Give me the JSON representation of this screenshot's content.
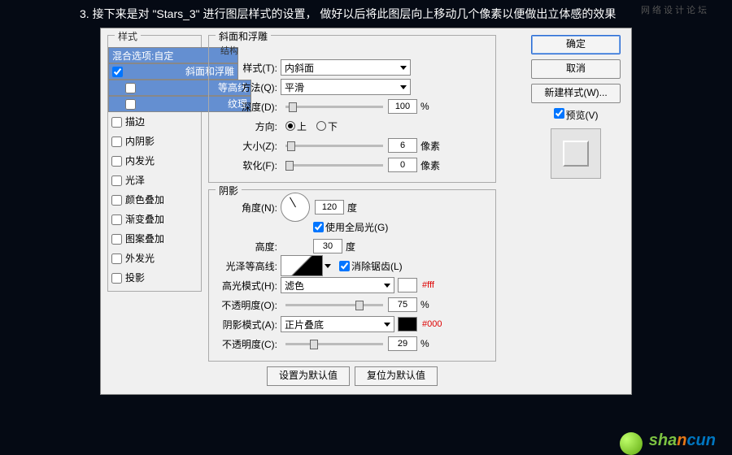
{
  "instruction": "3. 接下来是对 \"Stars_3\" 进行图层样式的设置，   做好以后将此图层向上移动几个像素以便做出立体感的效果",
  "watermark": "网络设计论坛",
  "styles": {
    "heading": "样式",
    "blend": "混合选项:自定",
    "items": [
      {
        "label": "斜面和浮雕",
        "checked": true,
        "sel": true,
        "indent": 0
      },
      {
        "label": "等高线",
        "checked": false,
        "sel": true,
        "indent": 1
      },
      {
        "label": "纹理",
        "checked": false,
        "sel": true,
        "indent": 1
      },
      {
        "label": "描边",
        "checked": false,
        "sel": false,
        "indent": 0
      },
      {
        "label": "内阴影",
        "checked": false,
        "sel": false,
        "indent": 0
      },
      {
        "label": "内发光",
        "checked": false,
        "sel": false,
        "indent": 0
      },
      {
        "label": "光泽",
        "checked": false,
        "sel": false,
        "indent": 0
      },
      {
        "label": "颜色叠加",
        "checked": false,
        "sel": false,
        "indent": 0
      },
      {
        "label": "渐变叠加",
        "checked": false,
        "sel": false,
        "indent": 0
      },
      {
        "label": "图案叠加",
        "checked": false,
        "sel": false,
        "indent": 0
      },
      {
        "label": "外发光",
        "checked": false,
        "sel": false,
        "indent": 0
      },
      {
        "label": "投影",
        "checked": false,
        "sel": false,
        "indent": 0
      }
    ]
  },
  "bevel": {
    "title": "斜面和浮雕",
    "structure": "结构",
    "style_l": "样式(T):",
    "style_v": "内斜面",
    "tech_l": "方法(Q):",
    "tech_v": "平滑",
    "depth_l": "深度(D):",
    "depth_v": "100",
    "depth_u": "%",
    "dir_l": "方向:",
    "up": "上",
    "down": "下",
    "size_l": "大小(Z):",
    "size_v": "6",
    "size_u": "像素",
    "soft_l": "软化(F):",
    "soft_v": "0",
    "soft_u": "像素"
  },
  "shade": {
    "title": "阴影",
    "angle_l": "角度(N):",
    "angle_v": "120",
    "deg": "度",
    "global": "使用全局光(G)",
    "alt_l": "高度:",
    "alt_v": "30",
    "gloss_l": "光泽等高线:",
    "anti": "消除锯齿(L)",
    "hilite_l": "高光模式(H):",
    "hilite_v": "滤色",
    "hilite_c": "#ffffff",
    "hilite_hex": "#fff",
    "hop_l": "不透明度(O):",
    "hop_v": "75",
    "pct": "%",
    "shadow_l": "阴影模式(A):",
    "shadow_v": "正片叠底",
    "shadow_c": "#000000",
    "shadow_hex": "#000",
    "sop_l": "不透明度(C):",
    "sop_v": "29"
  },
  "buttons": {
    "ok": "确定",
    "cancel": "取消",
    "newstyle": "新建样式(W)...",
    "preview": "预览(V)",
    "setdef": "设置为默认值",
    "resetdef": "复位为默认值"
  }
}
